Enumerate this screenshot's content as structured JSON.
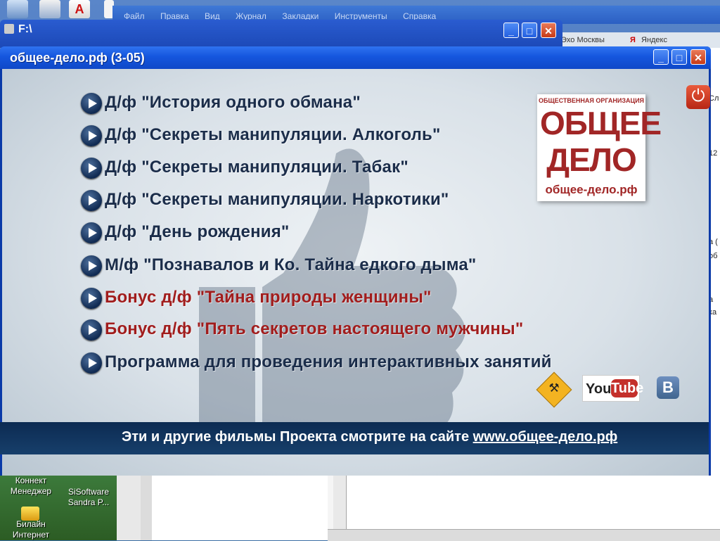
{
  "browser": {
    "menu": [
      "Файл",
      "Правка",
      "Вид",
      "Журнал",
      "Закладки",
      "Инструменты",
      "Справка"
    ],
    "bookmarks": [
      "Эхо Москвы",
      "Яндекс"
    ],
    "right_edge_text": [
      "Сл",
      "12",
      "а (",
      "об",
      "а",
      "ка"
    ]
  },
  "explorer": {
    "title": "F:\\"
  },
  "window": {
    "title": "общее-дело.рф (3-05)",
    "minimize": "_",
    "maximize": "□",
    "close": "✕"
  },
  "menu": {
    "items": [
      {
        "label": "Д/ф \"История одного обмана\"",
        "color": "#1b2d4a"
      },
      {
        "label": "Д/ф \"Секреты манипуляции. Алкоголь\"",
        "color": "#1b2d4a"
      },
      {
        "label": "Д/ф \"Секреты манипуляции. Табак\"",
        "color": "#1b2d4a"
      },
      {
        "label": "Д/ф \"Секреты манипуляции. Наркотики\"",
        "color": "#1b2d4a"
      },
      {
        "label": "Д/ф \"День рождения\"",
        "color": "#1b2d4a"
      },
      {
        "label": "М/ф \"Познавалов и Ко. Тайна едкого дыма\"",
        "color": "#1b2d4a"
      },
      {
        "label": "Бонус д/ф \"Тайна природы женщины\"",
        "color": "#a11d1d"
      },
      {
        "label": "Бонус д/ф \"Пять секретов настоящего мужчины\"",
        "color": "#a11d1d"
      },
      {
        "label": "Программа для проведения интерактивных занятий",
        "color": "#1b2d4a"
      }
    ]
  },
  "logo": {
    "subtitle": "ОБЩЕСТВЕННАЯ ОРГАНИЗАЦИЯ",
    "line1": "ОБЩЕЕ",
    "line2": "ДЕЛО",
    "url": "общее-дело.рф"
  },
  "social": {
    "youtube_you": "You",
    "youtube_tube": "Tube",
    "vk": "B",
    "tools_icon": "⚒",
    "power_icon": "⏻"
  },
  "banner": {
    "text": "Эти и другие фильмы Проекта смотрите на сайте ",
    "link": "www.общее-дело.рф"
  },
  "desktop": {
    "icons": [
      {
        "label": "Коннект Менеджер"
      },
      {
        "label": "SiSoftware Sandra P..."
      },
      {
        "label": "Билайн Интернет"
      }
    ]
  }
}
